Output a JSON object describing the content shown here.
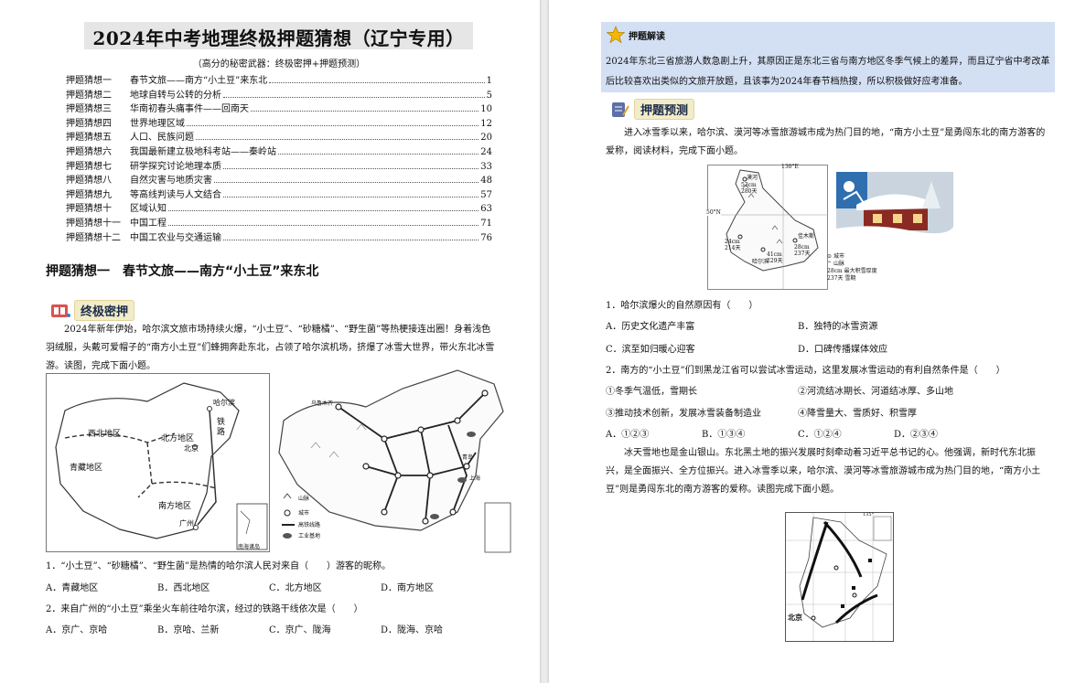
{
  "left_page": {
    "title": "2024年中考地理终极押题猜想（辽宁专用）",
    "subtitle": "（高分的秘密武器：终极密押+押题预测）",
    "toc": [
      {
        "no": "押题猜想一",
        "title": "春节文旅——南方“小土豆”来东北",
        "page": "1"
      },
      {
        "no": "押题猜想二",
        "title": "地球自转与公转的分析",
        "page": "5"
      },
      {
        "no": "押题猜想三",
        "title": "华南初春头痛事件——回南天",
        "page": "10"
      },
      {
        "no": "押题猜想四",
        "title": "世界地理区域",
        "page": "12"
      },
      {
        "no": "押题猜想五",
        "title": "人口、民族问题",
        "page": "20"
      },
      {
        "no": "押题猜想六",
        "title": "我国最新建立极地科考站——秦岭站",
        "page": "24"
      },
      {
        "no": "押题猜想七",
        "title": "研学探究讨论地理本质",
        "page": "33"
      },
      {
        "no": "押题猜想八",
        "title": "自然灾害与地质灾害",
        "page": "48"
      },
      {
        "no": "押题猜想九",
        "title": "等高线判读与人文结合",
        "page": "57"
      },
      {
        "no": "押题猜想十",
        "title": "区域认知",
        "page": "63"
      },
      {
        "no": "押题猜想十一",
        "title": "中国工程",
        "page": "71"
      },
      {
        "no": "押题猜想十二",
        "title": "中国工农业与交通运输",
        "page": "76"
      }
    ],
    "section_heading": "押题猜想一　春节文旅——南方“小土豆”来东北",
    "badge": "终极密押",
    "intro": "2024年新年伊始，哈尔滨文旅市场持续火爆，“小土豆”、“砂糖橘”、“野生菌”等热梗接连出圈！身着浅色羽绒服，头戴可爱帽子的“南方小土豆”们蜂拥奔赴东北，占领了哈尔滨机场，挤爆了冰雪大世界，带火东北冰雪游。读图，完成下面小题。",
    "map1_labels": {
      "harbin": "哈尔滨",
      "northwest": "西北地区",
      "north": "北方地区",
      "beijing": "北京",
      "qingzang": "青藏地区",
      "south": "南方地区",
      "guangzhou": "广州",
      "nanhai": "南海诸岛",
      "vertical_text": "铁路"
    },
    "map2_labels": {
      "urumqi": "乌鲁木齐",
      "qingdao": "青岛",
      "shanghai": "上海",
      "legend_mountain": "山脉",
      "legend_city": "城市",
      "legend_rail": "高铁线路",
      "legend_industry": "工业基地"
    },
    "q1": "1．“小土豆”、“砂糖橘”、“野生菌”是热情的哈尔滨人民对来自（　　）游客的昵称。",
    "q1_opts": [
      "A．青藏地区",
      "B．西北地区",
      "C．北方地区",
      "D．南方地区"
    ],
    "q2": "2．来自广州的“小土豆”乘坐火车前往哈尔滨，经过的铁路干线依次是（　　）",
    "q2_opts": [
      "A．京广、京哈",
      "B．京哈、兰新",
      "C．京广、陇海",
      "D．陇海、京哈"
    ]
  },
  "right_page": {
    "badge1": "押题解读",
    "analysis": "2024年东北三省旅游人数急剧上升，其原因正是东北三省与南方地区冬季气候上的差异，而且辽宁省中考改革后比较喜欢出类似的文旅开放题，且该事为2024年春节档热搜，所以积极做好应考准备。",
    "badge2": "押题预测",
    "intro2": "进入冰雪季以来，哈尔滨、漠河等冰雪旅游城市成为热门目的地，“南方小土豆”是勇闯东北的南方游客的爱称，阅读材料，完成下面小题。",
    "map3_labels": {
      "lon": "130°E",
      "lat": "50°N",
      "mohe": "漠河",
      "mohe_vals": "53cm 280天",
      "jiamusi": "佳木斯",
      "jiamusi_vals": "28cm 237天",
      "harbin_vals": "41cm 229天",
      "west_vals": "24cm 214天",
      "harbin": "哈尔滨",
      "legend_city": "城市",
      "legend_mountain": "山脉",
      "legend_snow": "28cm 最大积雪厚度",
      "legend_days": "237天 雪期"
    },
    "q1": "1．哈尔滨爆火的自然原因有（　　）",
    "q1_opts": [
      "A．历史文化遗产丰富",
      "B．独特的冰雪资源",
      "C．滨至如归暖心迎客",
      "D．口碑传播媒体效应"
    ],
    "q2": "2．南方的“小土豆”们到黑龙江省可以尝试冰雪运动，这里发展冰雪运动的有利自然条件是（　　）",
    "q2_items": [
      "①冬季气温低，雪期长",
      "②河流结冰期长、河道结冰厚、多山地",
      "③推动技术创新，发展冰雪装备制造业",
      "④降雪量大、雪质好、积雪厚"
    ],
    "q2_opts": [
      "A．①②③",
      "B．①③④",
      "C．①②④",
      "D．②③④"
    ],
    "intro3": "冰天雪地也是金山银山。东北黑土地的振兴发展时刻牵动着习近平总书记的心。他强调，新时代东北振兴，是全面振兴、全方位振兴。进入冰雪季以来，哈尔滨、漠河等冰雪旅游城市成为热门目的地，“南方小土豆”则是勇闯东北的南方游客的爱称。读图完成下面小题。",
    "map4_labels": {
      "beijing": "北京",
      "lon": "135°"
    }
  },
  "colors": {
    "blue_box": "#d3dff3",
    "title_bg": "#e6e6e6",
    "badge_bg": "#f2ecc9",
    "gray_bg": "#ececec"
  }
}
